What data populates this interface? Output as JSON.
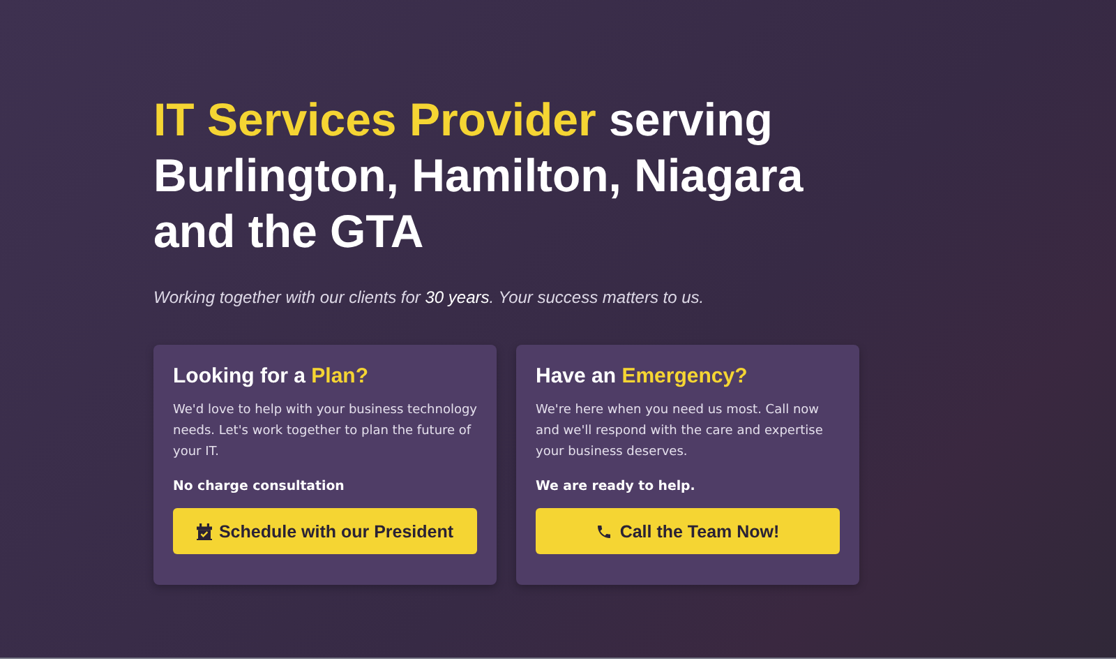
{
  "hero": {
    "headline_highlight": "IT Services Provider",
    "headline_rest": "serving Burlington, Hamilton, Niagara and the GTA",
    "tagline": "Working together with our clients for **30 years**. Your success matters to us."
  },
  "cards": [
    {
      "title": "Looking for a",
      "title_highlight": "Plan?",
      "body": "We'd love to help with your business technology needs. Let's work together to plan the future of your IT.",
      "note": "No charge consultation",
      "button": "Schedule with our President",
      "kind": "schedule"
    },
    {
      "title": "Have an",
      "title_highlight": "Emergency?",
      "body": "We're here when you need us most. Call now and we'll respond with the care and expertise your business deserves.",
      "note": "We are ready to help.",
      "button": "Call the Team Now!",
      "kind": "call"
    }
  ]
}
